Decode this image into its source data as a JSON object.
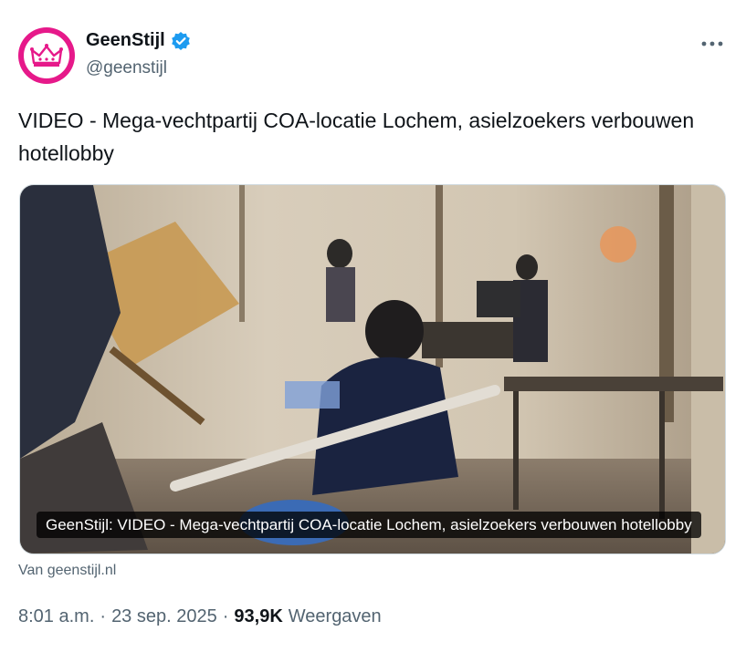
{
  "account": {
    "display_name": "GeenStijl",
    "handle": "@geenstijl",
    "verified_color": "#1d9bf0",
    "avatar_color": "#e6198a"
  },
  "tweet": {
    "text": "VIDEO - Mega-vechtpartij COA-locatie Lochem, asielzoekers verbouwen hotellobby"
  },
  "card": {
    "title": "GeenStijl: VIDEO - Mega-vechtpartij COA-locatie Lochem, asielzoekers verbouwen hotellobby",
    "source": "Van geenstijl.nl"
  },
  "meta": {
    "time": "8:01 a.m.",
    "separator": "·",
    "date": "23 sep. 2025",
    "views_count": "93,9K",
    "views_label": "Weergaven"
  },
  "icons": {
    "more": "more-horizontal-icon",
    "verified": "verified-badge-icon",
    "avatar_logo": "crown-icon"
  }
}
